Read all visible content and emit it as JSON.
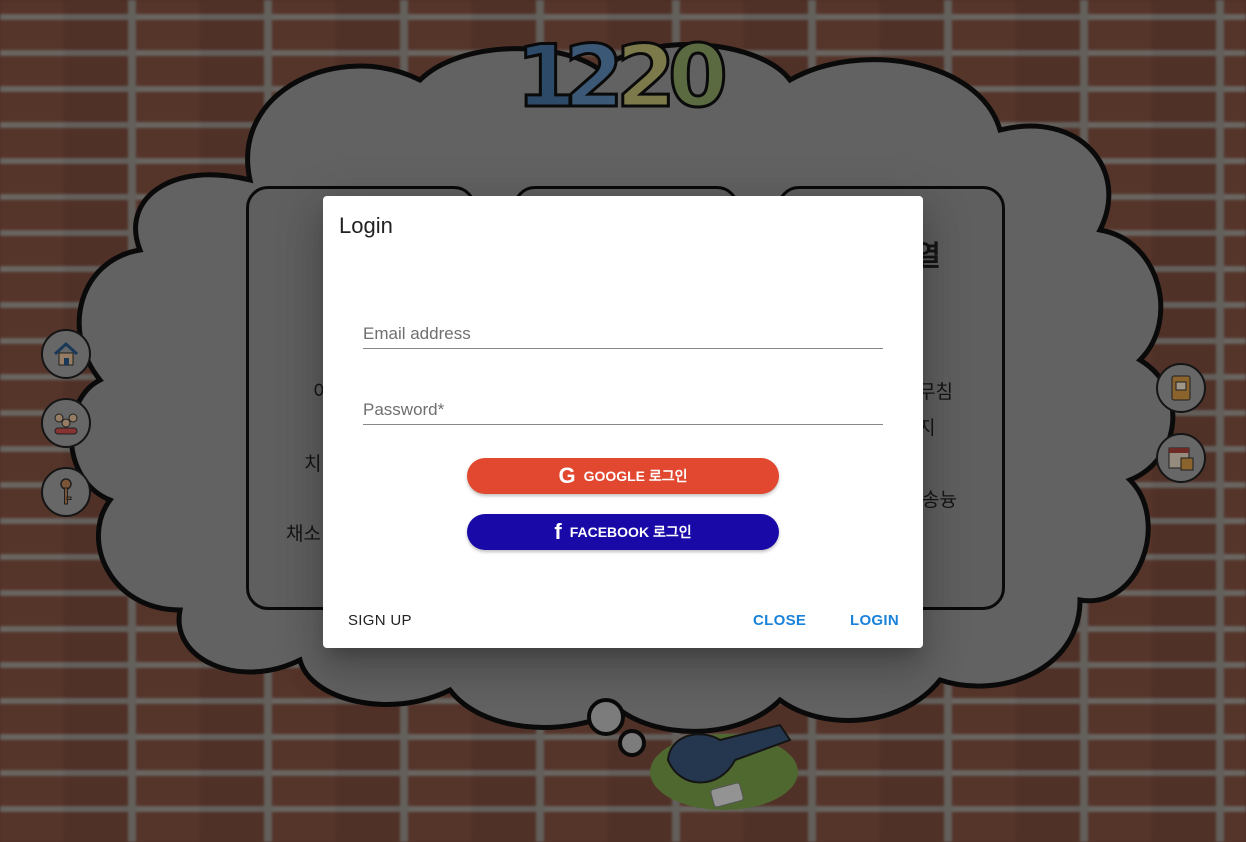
{
  "background": {
    "logo_text": "1220",
    "card_fragments": [
      "이",
      "치",
      "채소",
      "열",
      "무침",
      "지",
      "송늉"
    ]
  },
  "side_icons_left": [
    "house-icon",
    "people-icon",
    "key-icon"
  ],
  "side_icons_right": [
    "notebook-icon",
    "calendar-icon"
  ],
  "dialog": {
    "title": "Login",
    "email": {
      "placeholder": "Email address",
      "value": ""
    },
    "password": {
      "placeholder": "Password*",
      "value": ""
    },
    "google_button": {
      "icon": "G",
      "label": "GOOGLE 로그인",
      "color": "#e2472f"
    },
    "facebook_button": {
      "icon": "f",
      "label": "FACEBOOK 로그인",
      "color": "#190aa8"
    },
    "actions": {
      "signup": "SIGN UP",
      "close": "CLOSE",
      "login": "LOGIN"
    },
    "accent_color": "#1a82d8"
  }
}
